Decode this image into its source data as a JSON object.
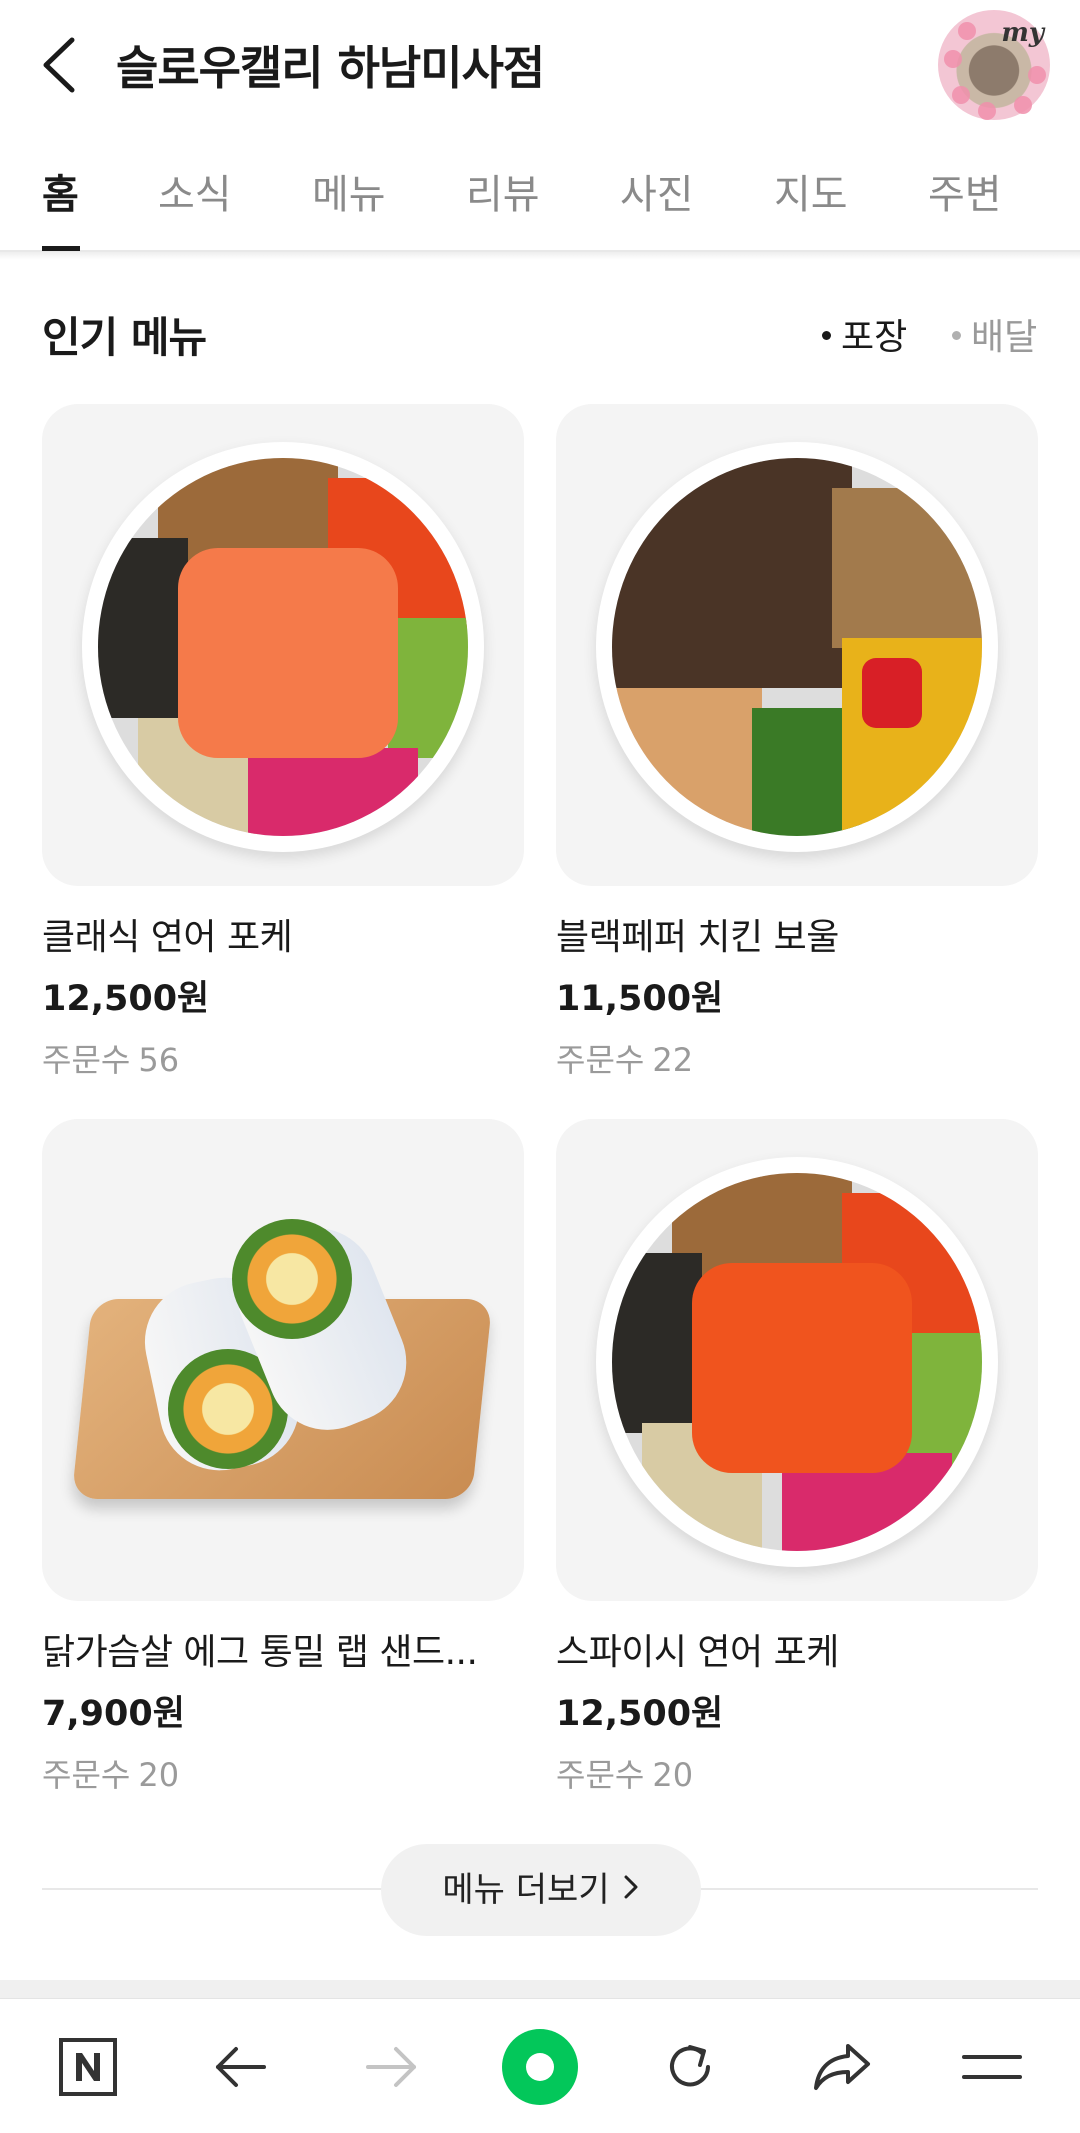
{
  "header": {
    "title": "슬로우캘리 하남미사점",
    "avatar_label": "my"
  },
  "tabs": [
    {
      "label": "홈",
      "active": true
    },
    {
      "label": "소식",
      "active": false
    },
    {
      "label": "메뉴",
      "active": false
    },
    {
      "label": "리뷰",
      "active": false
    },
    {
      "label": "사진",
      "active": false
    },
    {
      "label": "지도",
      "active": false
    },
    {
      "label": "주변",
      "active": false
    }
  ],
  "section": {
    "title": "인기 메뉴",
    "filters": [
      {
        "label": "포장",
        "selected": true
      },
      {
        "label": "배달",
        "selected": false
      }
    ]
  },
  "menu": [
    {
      "name": "클래식 연어 포케",
      "price": "12,500원",
      "orders_label": "주문수",
      "orders": "56"
    },
    {
      "name": "블랙페퍼 치킨 보울",
      "price": "11,500원",
      "orders_label": "주문수",
      "orders": "22"
    },
    {
      "name": "닭가슴살 에그 통밀 랩 샌드...",
      "price": "7,900원",
      "orders_label": "주문수",
      "orders": "20"
    },
    {
      "name": "스파이시 연어 포케",
      "price": "12,500원",
      "orders_label": "주문수",
      "orders": "20"
    }
  ],
  "more_button": {
    "label": "메뉴 더보기"
  },
  "bottom_nav": [
    {
      "icon": "naver-n-icon"
    },
    {
      "icon": "back-arrow-icon"
    },
    {
      "icon": "forward-arrow-icon",
      "enabled": false
    },
    {
      "icon": "green-circle-icon"
    },
    {
      "icon": "refresh-icon"
    },
    {
      "icon": "share-icon"
    },
    {
      "icon": "menu-icon"
    }
  ],
  "colors": {
    "text_primary": "#1a1a1a",
    "text_secondary": "#9a9a9a",
    "accent_green": "#03c75a"
  }
}
